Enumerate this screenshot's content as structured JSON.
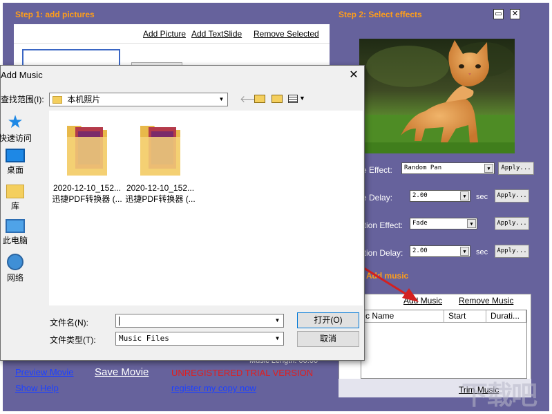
{
  "step1": {
    "title": "Step 1: add pictures",
    "add_picture": "Add Picture",
    "add_textslide": "Add TextSlide",
    "remove_selected": "Remove Selected"
  },
  "step2": {
    "title": "Step 2: Select effects",
    "image_effect_label": "e Effect:",
    "image_effect_value": "Random Pan",
    "image_delay_label": "e Delay:",
    "image_delay_value": "2.00",
    "transition_effect_label": "ition Effect:",
    "transition_effect_value": "Fade",
    "transition_delay_label": "ition Delay:",
    "transition_delay_value": "2.00",
    "apply_label": "Apply...",
    "sec_label": "sec"
  },
  "step3": {
    "title": ": Add music",
    "add_music": "Add Music",
    "remove_music": "Remove Music",
    "columns": [
      "c Name",
      "Start",
      "Durati..."
    ],
    "trim_music": "Trim Music"
  },
  "bottom": {
    "music_length": "Music Length: 00:00",
    "preview_movie": "Preview Movie",
    "save_movie": "Save Movie",
    "unregistered": "UNREGISTERED TRIAL VERSION",
    "show_help": "Show Help",
    "register": "register my copy now"
  },
  "dialog": {
    "title": "Add Music",
    "close": "✕",
    "look_in_label": "查找范围(I):",
    "look_in_value": "本机照片",
    "places": [
      {
        "label": "快速访问"
      },
      {
        "label": "桌面"
      },
      {
        "label": "库"
      },
      {
        "label": "此电脑"
      },
      {
        "label": "网络"
      }
    ],
    "files": [
      {
        "name": "2020-12-10_152...",
        "sub": "迅捷PDF转换器 (..."
      },
      {
        "name": "2020-12-10_152...",
        "sub": "迅捷PDF转换器 (..."
      }
    ],
    "filename_label": "文件名(N):",
    "filename_value": "",
    "filetype_label": "文件类型(T):",
    "filetype_value": "Music Files",
    "open_button": "打开(O)",
    "cancel_button": "取消"
  },
  "window_buttons": {
    "minimize": "▭",
    "close": "✕"
  },
  "colors": {
    "app_background": "#66629c",
    "step_title": "#ff9e1a",
    "link_blue": "#1d41ff",
    "unregistered_red": "#e01e1e",
    "arrow_red": "#d42020"
  },
  "icons": [
    "folder-icon",
    "back-arrow-icon",
    "up-folder-icon",
    "new-folder-icon",
    "view-menu-icon",
    "star-icon",
    "desktop-icon",
    "library-icon",
    "computer-icon",
    "network-icon",
    "kitten-photo"
  ]
}
